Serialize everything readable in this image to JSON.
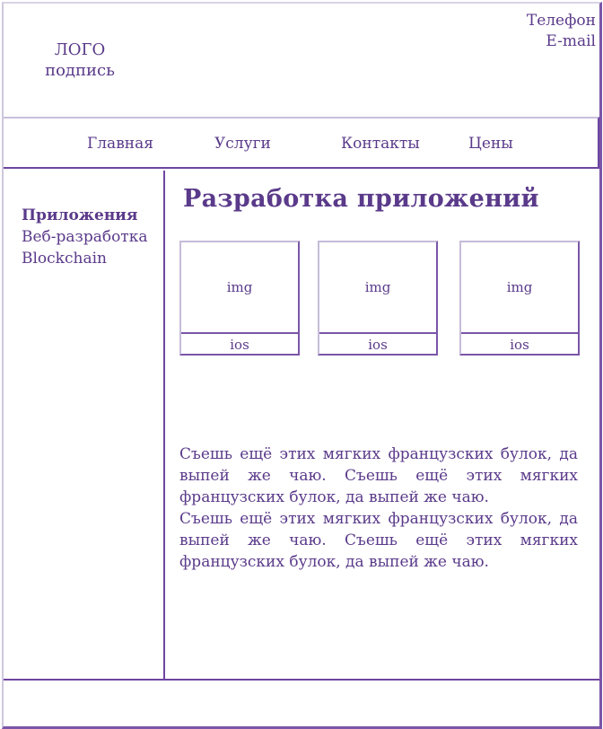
{
  "header": {
    "logo": "ЛОГО",
    "logo_caption": "подпись",
    "phone": "Телефон",
    "email": "E-mail"
  },
  "nav": {
    "items": [
      {
        "label": "Главная"
      },
      {
        "label": "Услуги"
      },
      {
        "label": "Контакты"
      },
      {
        "label": "Цены"
      }
    ]
  },
  "sidebar": {
    "items": [
      {
        "label": "Приложения",
        "active": true
      },
      {
        "label": "Веб-разработка"
      },
      {
        "label": "Blockchain"
      }
    ]
  },
  "main": {
    "title": "Разработка приложений",
    "cards": [
      {
        "image": "img",
        "label": "ios"
      },
      {
        "image": "img",
        "label": "ios"
      },
      {
        "image": "img",
        "label": "ios"
      }
    ],
    "paragraphs": [
      "Съешь ещё этих мягких французских булок, да выпей же чаю. Съешь ещё этих мягких французских булок, да выпей же чаю.",
      "Съешь ещё этих мягких французских булок, да выпей же чаю. Съешь ещё этих мягких французских булок, да выпей же чаю."
    ]
  },
  "colors": {
    "accent": "#5a3a8a",
    "border": "#7a55a8"
  }
}
